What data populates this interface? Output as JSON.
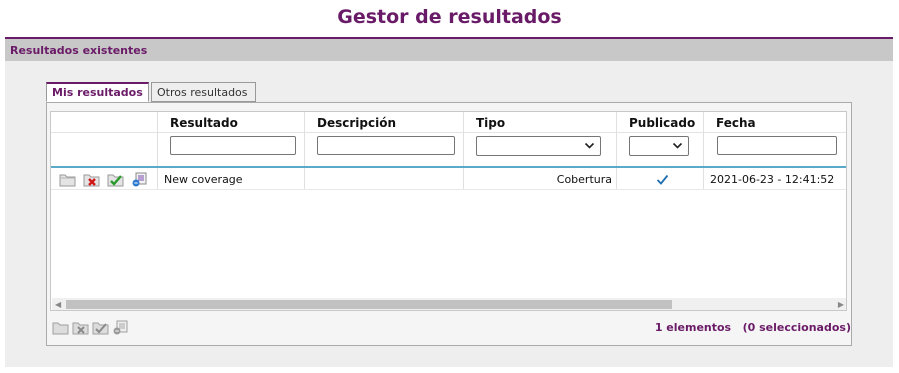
{
  "page": {
    "title": "Gestor de resultados"
  },
  "section": {
    "title": "Resultados existentes"
  },
  "tabs": [
    {
      "label": "Mis resultados"
    },
    {
      "label": "Otros resultados"
    }
  ],
  "table": {
    "columns": [
      "Resultado",
      "Descripción",
      "Tipo",
      "Publicado",
      "Fecha"
    ],
    "rows": [
      {
        "resultado": "New coverage",
        "descripcion": "",
        "tipo": "Cobertura",
        "publicado": true,
        "fecha": "2021-06-23 - 12:41:52"
      }
    ],
    "row_action_icons": [
      "open-folder-icon",
      "delete-icon",
      "publish-icon",
      "share-icon"
    ]
  },
  "footer": {
    "count_text": "1 elementos",
    "selected_text": "(0 seleccionados)",
    "action_icons": [
      "open-folder-icon",
      "delete-icon",
      "publish-icon",
      "share-icon"
    ]
  },
  "colors": {
    "accent": "#6a1b67",
    "header_bar": "#c8c8c8",
    "grid_divider": "#5ba9c8"
  }
}
